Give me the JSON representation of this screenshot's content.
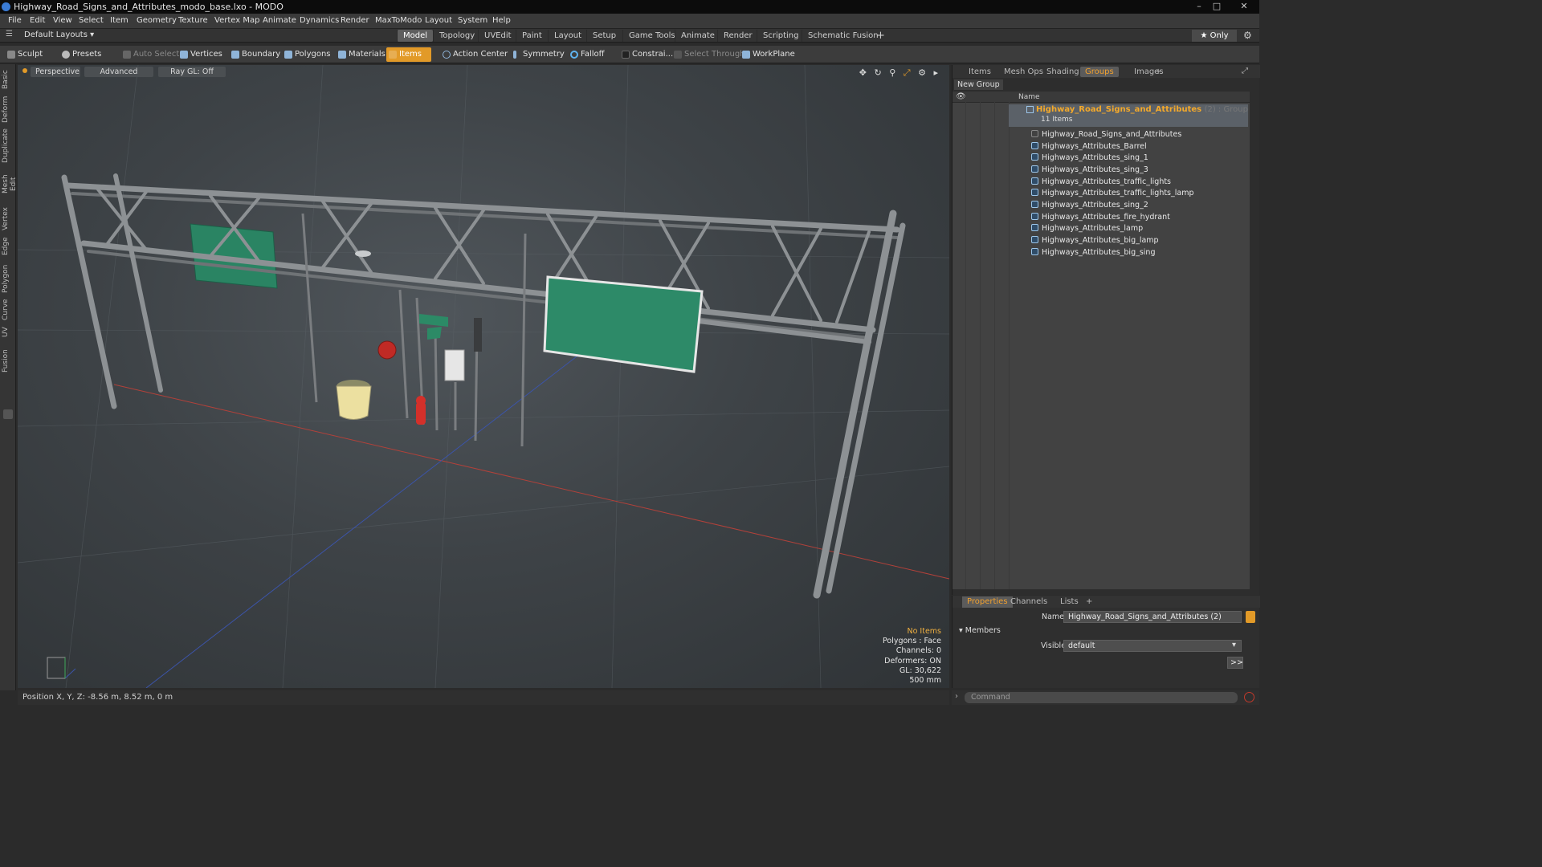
{
  "window": {
    "title": "Highway_Road_Signs_and_Attributes_modo_base.lxo - MODO",
    "controls": [
      "–",
      "□",
      "✕"
    ]
  },
  "menu": [
    "File",
    "Edit",
    "View",
    "Select",
    "Item",
    "Geometry",
    "Texture",
    "Vertex Map",
    "Animate",
    "Dynamics",
    "Render",
    "MaxToModo",
    "Layout",
    "System",
    "Help"
  ],
  "layout": {
    "selector": "Default Layouts ▾",
    "tabs": [
      "Model",
      "Topology",
      "UVEdit",
      "Paint",
      "Layout",
      "Setup",
      "Game Tools",
      "Animate",
      "Render",
      "Scripting",
      "Schematic Fusion"
    ],
    "active_tab": "Model",
    "add": "+",
    "only": "★ Only"
  },
  "toolbar": {
    "sculpt": "Sculpt",
    "presets": "Presets",
    "auto_select": "Auto Select",
    "vertices": "Vertices",
    "boundary": "Boundary",
    "polygons": "Polygons",
    "materials": "Materials",
    "items": "Items",
    "action_center": "Action Center",
    "symmetry": "Symmetry",
    "falloff": "Falloff",
    "constraints": "Constrai...",
    "select_through": "Select Through",
    "workplane": "WorkPlane"
  },
  "left_strip": [
    "Basic",
    "Deform",
    "Duplicate",
    "Mesh Edit",
    "Vertex",
    "Edge",
    "Polygon",
    "Curve",
    "UV",
    "Fusion"
  ],
  "viewport": {
    "view": "Perspective",
    "shading": "Advanced",
    "raygl": "Ray GL: Off",
    "info": {
      "selection": "No Items",
      "polygons": "Polygons : Face",
      "channels": "Channels: 0",
      "deformers": "Deformers: ON",
      "gl": "GL: 30,622",
      "grid": "500 mm"
    }
  },
  "status": {
    "position": "Position X, Y, Z:  -8.56 m, 8.52 m, 0 m"
  },
  "right_panel": {
    "tabs": [
      "Items",
      "Mesh Ops",
      "Shading",
      "Groups",
      "Images",
      "+"
    ],
    "active_tab": "Groups",
    "new_group": "New Group",
    "col_name": "Name",
    "group": {
      "name": "Highway_Road_Signs_and_Attributes",
      "count": "(2) : Group",
      "items_label": "11 Items"
    },
    "items": [
      "Highway_Road_Signs_and_Attributes",
      "Highways_Attributes_Barrel",
      "Highways_Attributes_sing_1",
      "Highways_Attributes_sing_3",
      "Highways_Attributes_traffic_lights",
      "Highways_Attributes_traffic_lights_lamp",
      "Highways_Attributes_sing_2",
      "Highways_Attributes_fire_hydrant",
      "Highways_Attributes_lamp",
      "Highways_Attributes_big_lamp",
      "Highways_Attributes_big_sing"
    ]
  },
  "properties": {
    "tabs": [
      "Properties",
      "Channels",
      "Lists",
      "+"
    ],
    "name_label": "Name",
    "name_value": "Highway_Road_Signs_and_Attributes (2)",
    "members_label": "Members",
    "visible_label": "Visible",
    "visible_value": "default",
    "arrow_btn": ">>"
  },
  "command": {
    "placeholder": "Command"
  },
  "colors": {
    "accent": "#e29a28",
    "group_text": "#f3a92b",
    "sign_green": "#2d8a68",
    "red_axis": "#c0392b",
    "blue_axis": "#3a4fa0"
  }
}
